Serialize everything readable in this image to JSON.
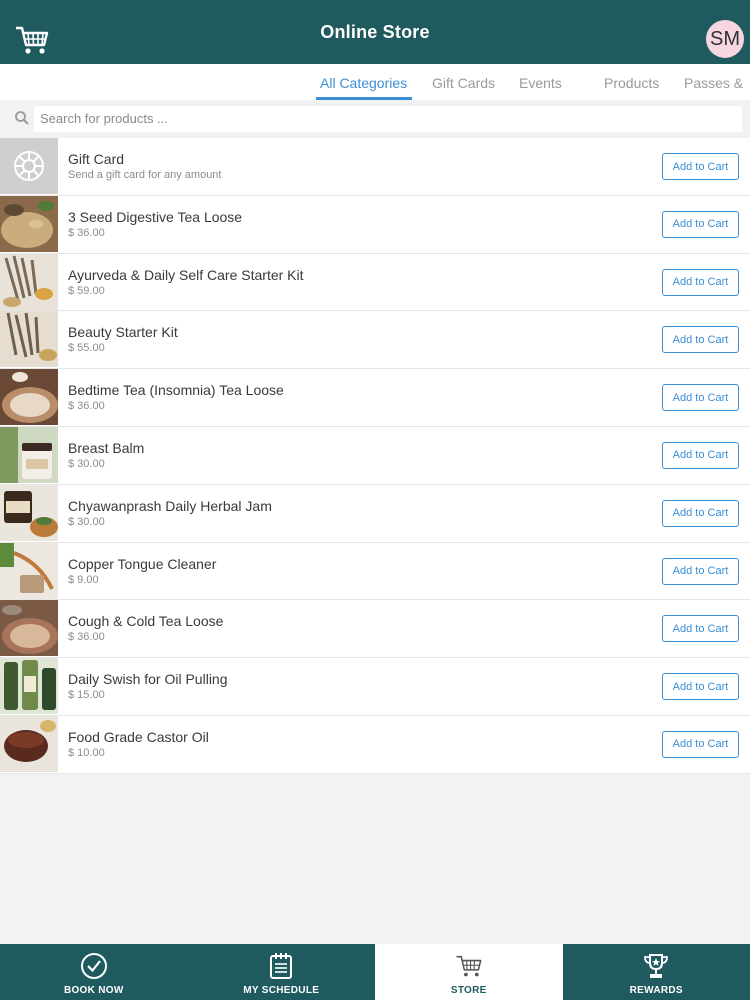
{
  "header": {
    "title": "Online Store",
    "avatar_initials": "SM",
    "cart_icon": "cart-icon"
  },
  "tabs": [
    {
      "label": "All Categories",
      "active": true
    },
    {
      "label": "Gift Cards",
      "active": false
    },
    {
      "label": "Events",
      "active": false
    },
    {
      "label": "Products",
      "active": false
    },
    {
      "label": "Passes &",
      "active": false
    }
  ],
  "search": {
    "placeholder": "Search for products ...",
    "value": ""
  },
  "products": [
    {
      "name": "Gift Card",
      "sub": "Send a gift card for any amount",
      "button": "Add to Cart"
    },
    {
      "name": "3 Seed Digestive Tea Loose",
      "sub": "$ 36.00",
      "button": "Add to Cart"
    },
    {
      "name": "Ayurveda & Daily Self Care Starter Kit",
      "sub": "$ 59.00",
      "button": "Add to Cart"
    },
    {
      "name": "Beauty Starter Kit",
      "sub": "$ 55.00",
      "button": "Add to Cart"
    },
    {
      "name": "Bedtime Tea (Insomnia) Tea Loose",
      "sub": "$ 36.00",
      "button": "Add to Cart"
    },
    {
      "name": "Breast Balm",
      "sub": "$ 30.00",
      "button": "Add to Cart"
    },
    {
      "name": "Chyawanprash Daily Herbal Jam",
      "sub": "$ 30.00",
      "button": "Add to Cart"
    },
    {
      "name": "Copper Tongue Cleaner",
      "sub": "$ 9.00",
      "button": "Add to Cart"
    },
    {
      "name": "Cough & Cold Tea Loose",
      "sub": "$ 36.00",
      "button": "Add to Cart"
    },
    {
      "name": "Daily Swish for Oil Pulling",
      "sub": "$ 15.00",
      "button": "Add to Cart"
    },
    {
      "name": "Food Grade Castor Oil",
      "sub": "$ 10.00",
      "button": "Add to Cart"
    }
  ],
  "bottom_nav": [
    {
      "label": "BOOK NOW",
      "icon": "check-circle-icon",
      "active": false
    },
    {
      "label": "MY SCHEDULE",
      "icon": "calendar-icon",
      "active": false
    },
    {
      "label": "STORE",
      "icon": "cart-icon",
      "active": true
    },
    {
      "label": "REWARDS",
      "icon": "trophy-icon",
      "active": false
    }
  ],
  "colors": {
    "header_bg": "#1f5a5e",
    "accent": "#3a8fd6",
    "avatar_bg": "#f7d6e2"
  }
}
